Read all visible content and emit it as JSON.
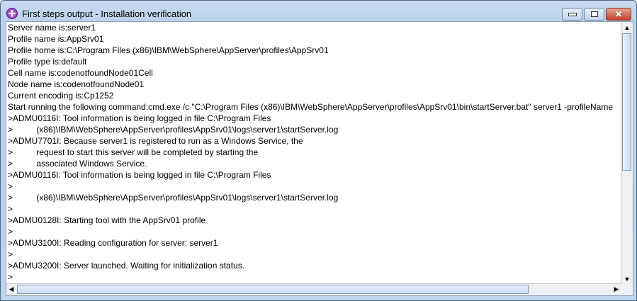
{
  "window": {
    "title": "First steps output  - Installation verification",
    "minimize": "—",
    "maximize": "▫",
    "close": "✕"
  },
  "lines": [
    "Server name is:server1",
    "Profile name is:AppSrv01",
    "Profile home is:C:\\Program Files (x86)\\IBM\\WebSphere\\AppServer\\profiles\\AppSrv01",
    "Profile type is:default",
    "Cell name is:codenotfoundNode01Cell",
    "Node name is:codenotfoundNode01",
    "Current encoding is:Cp1252",
    "Start running the following command:cmd.exe /c \"C:\\Program Files (x86)\\IBM\\WebSphere\\AppServer\\profiles\\AppSrv01\\bin\\startServer.bat\" server1 -profileName",
    ">ADMU0116I: Tool information is being logged in file C:\\Program Files",
    ">          (x86)\\IBM\\WebSphere\\AppServer\\profiles\\AppSrv01\\logs\\server1\\startServer.log",
    ">ADMU7701I: Because server1 is registered to run as a Windows Service, the",
    ">          request to start this server will be completed by starting the",
    ">          associated Windows Service.",
    ">ADMU0116I: Tool information is being logged in file C:\\Program Files",
    ">",
    ">          (x86)\\IBM\\WebSphere\\AppServer\\profiles\\AppSrv01\\logs\\server1\\startServer.log",
    ">",
    ">ADMU0128I: Starting tool with the AppSrv01 profile",
    ">",
    ">ADMU3100I: Reading configuration for server: server1",
    ">",
    ">ADMU3200I: Server launched. Waiting for initialization status.",
    ">"
  ]
}
